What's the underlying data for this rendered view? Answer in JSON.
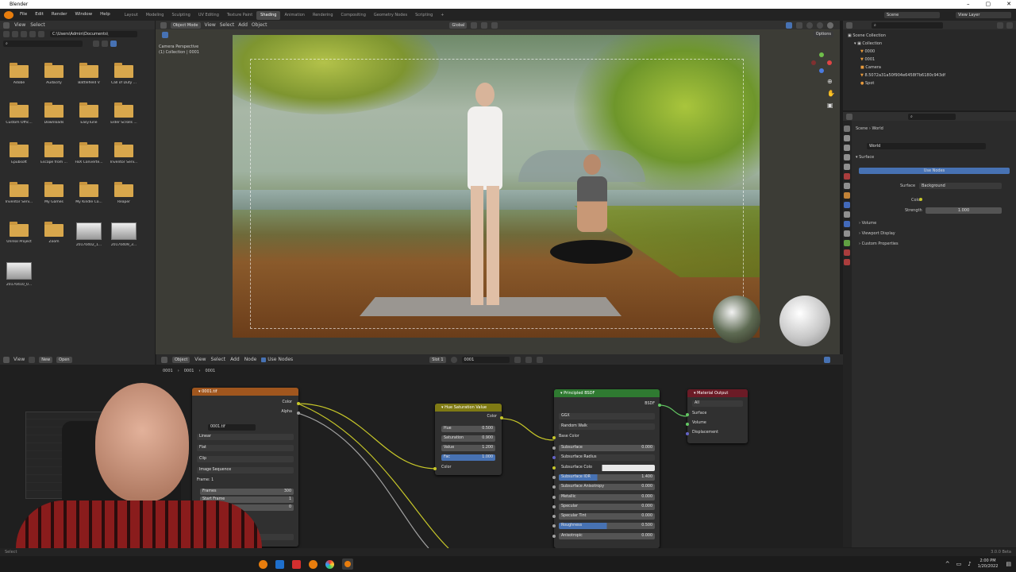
{
  "window": {
    "title": "Blender"
  },
  "menu": {
    "items": [
      "File",
      "Edit",
      "Render",
      "Window",
      "Help"
    ],
    "workspaces": [
      "Layout",
      "Modeling",
      "Sculpting",
      "UV Editing",
      "Texture Paint",
      "Shading",
      "Animation",
      "Rendering",
      "Compositing",
      "Geometry Nodes",
      "Scripting"
    ],
    "active_workspace": "Shading",
    "scene": "Scene",
    "view_layer": "View Layer"
  },
  "file_browser": {
    "view": "View",
    "select": "Select",
    "path": "C:\\Users\\Admin\\Documents\\",
    "items": [
      {
        "label": "Adobe",
        "kind": "folder"
      },
      {
        "label": "Audacity",
        "kind": "folder"
      },
      {
        "label": "Battlefield V",
        "kind": "folder"
      },
      {
        "label": "Call of Duty ...",
        "kind": "folder"
      },
      {
        "label": "Custom Offic...",
        "kind": "folder"
      },
      {
        "label": "Downloads",
        "kind": "folder"
      },
      {
        "label": "EasyTune",
        "kind": "folder"
      },
      {
        "label": "Elder Scrolls ...",
        "kind": "folder"
      },
      {
        "label": "Epubsoft",
        "kind": "folder"
      },
      {
        "label": "Escape from ...",
        "kind": "folder"
      },
      {
        "label": "FBX Converte...",
        "kind": "folder"
      },
      {
        "label": "Inventor Serv...",
        "kind": "folder"
      },
      {
        "label": "Inventor Serv...",
        "kind": "folder"
      },
      {
        "label": "My Games",
        "kind": "folder"
      },
      {
        "label": "My Kindle Co...",
        "kind": "folder"
      },
      {
        "label": "Reaper",
        "kind": "folder"
      },
      {
        "label": "Unreal Project",
        "kind": "folder"
      },
      {
        "label": "Zoom",
        "kind": "folder"
      },
      {
        "label": "20170402_1...",
        "kind": "image"
      },
      {
        "label": "20170409_3...",
        "kind": "image"
      },
      {
        "label": "20170410_0...",
        "kind": "image"
      }
    ]
  },
  "viewport": {
    "mode": "Object Mode",
    "menus": [
      "View",
      "Select",
      "Add",
      "Object"
    ],
    "transform": "Global",
    "camera_label": "Camera Perspective",
    "collection_label": "(1) Collection | 0001",
    "options": "Options"
  },
  "outliner": {
    "root": "Scene Collection",
    "items": [
      "Collection",
      "0000",
      "0001",
      "Camera",
      "8.5072a31a50f904e6458f7b6180c943df",
      "Spot"
    ]
  },
  "properties": {
    "breadcrumb": [
      "Scene",
      "World"
    ],
    "world_name": "World",
    "sections": {
      "surface": "Surface",
      "use_nodes": "Use Nodes",
      "surface_label": "Surface",
      "surface_value": "Background",
      "color_label": "Color",
      "strength_label": "Strength",
      "strength_value": "1.000",
      "volume": "Volume",
      "viewport_display": "Viewport Display",
      "custom_properties": "Custom Properties"
    }
  },
  "image_editor_header": {
    "view": "View",
    "new": "New",
    "open": "Open"
  },
  "node_editor": {
    "header": {
      "object": "Object",
      "menus": [
        "View",
        "Select",
        "Add",
        "Node"
      ],
      "use_nodes": "Use Nodes",
      "slot": "Slot 1",
      "material": "0001"
    },
    "breadcrumb": [
      "0001",
      "0001",
      "0001"
    ],
    "image_node": {
      "title": "0001.tif",
      "out_color": "Color",
      "out_alpha": "Alpha",
      "image": "0001.tif",
      "interp": "Linear",
      "proj": "Flat",
      "ext": "Clip",
      "source": "Image Sequence",
      "frame": "Frame: 1",
      "frames_label": "Frames",
      "frames_value": "300",
      "start_label": "Start Frame",
      "start_value": "1",
      "offset_label": "Offset",
      "offset_value": "0",
      "colorspace": "sRGB"
    },
    "hsv_node": {
      "title": "Hue Saturation Value",
      "out_color": "Color",
      "hue_label": "Hue",
      "hue_value": "0.500",
      "sat_label": "Saturation",
      "sat_value": "0.900",
      "val_label": "Value",
      "val_value": "1.200",
      "fac_label": "Fac",
      "fac_value": "1.000",
      "in_color": "Color"
    },
    "bsdf_node": {
      "title": "Principled BSDF",
      "out": "BSDF",
      "distribution": "GGX",
      "sss_method": "Random Walk",
      "base_color": "Base Color",
      "fields": [
        {
          "label": "Subsurface",
          "value": "0.000"
        },
        {
          "label": "Subsurface Radius",
          "value": ""
        },
        {
          "label": "Subsurface Colo",
          "value": ""
        },
        {
          "label": "Subsurface IOR",
          "value": "1.400"
        },
        {
          "label": "Subsurface Anisotropy",
          "value": "0.000"
        },
        {
          "label": "Metallic",
          "value": "0.000"
        },
        {
          "label": "Specular",
          "value": "0.000"
        },
        {
          "label": "Specular Tint",
          "value": "0.000"
        },
        {
          "label": "Roughness",
          "value": "0.500"
        },
        {
          "label": "Anisotropic",
          "value": "0.000"
        }
      ]
    },
    "output_node": {
      "title": "Material Output",
      "target": "All",
      "surface": "Surface",
      "volume": "Volume",
      "displacement": "Displacement"
    }
  },
  "statusbar": {
    "left": "Select",
    "version": "3.0.0 Beta"
  },
  "taskbar": {
    "time": "2:00 PM",
    "date": "1/20/2022"
  },
  "colors": {
    "accent": "#4772b3",
    "image_header": "#a0561e",
    "hsv_header": "#7f7a14",
    "bsdf_header": "#2f7a31",
    "output_header": "#6b1b26",
    "yellow_socket": "#c7c729",
    "gray_socket": "#a1a1a1",
    "green_socket": "#63c763",
    "purple_socket": "#6363c7"
  }
}
